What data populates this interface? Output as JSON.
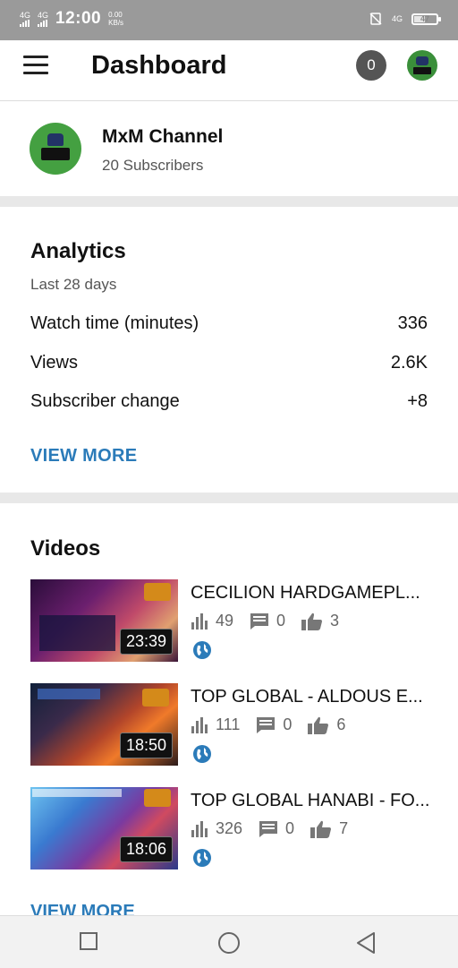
{
  "status_bar": {
    "network_1": "4G",
    "network_2": "4G",
    "time": "12:00",
    "speed_value": "0.00",
    "speed_unit": "KB/s",
    "network_right": "4G",
    "battery": "47"
  },
  "app_bar": {
    "title": "Dashboard",
    "notification_count": "0"
  },
  "channel": {
    "name": "MxM Channel",
    "subscribers": "20 Subscribers"
  },
  "analytics": {
    "heading": "Analytics",
    "period": "Last 28 days",
    "rows": [
      {
        "label": "Watch time (minutes)",
        "value": "336"
      },
      {
        "label": "Views",
        "value": "2.6K"
      },
      {
        "label": "Subscriber change",
        "value": "+8"
      }
    ],
    "view_more": "VIEW MORE"
  },
  "videos": {
    "heading": "Videos",
    "items": [
      {
        "title": "CECILION HARDGAMEPL...",
        "duration": "23:39",
        "views": "49",
        "comments": "0",
        "likes": "3"
      },
      {
        "title": "TOP GLOBAL - ALDOUS E...",
        "duration": "18:50",
        "views": "111",
        "comments": "0",
        "likes": "6"
      },
      {
        "title": "TOP GLOBAL HANABI - FO...",
        "duration": "18:06",
        "views": "326",
        "comments": "0",
        "likes": "7"
      }
    ],
    "view_more": "VIEW MORE"
  },
  "icons": {
    "menu": "hamburger-menu-icon",
    "views": "bar-chart-icon",
    "comments": "comment-icon",
    "likes": "thumbs-up-icon",
    "visibility": "globe-icon",
    "nav_recent": "square-icon",
    "nav_home": "circle-icon",
    "nav_back": "triangle-back-icon"
  },
  "colors": {
    "accent": "#2b7bb9",
    "status_bar": "#9a9a9a",
    "badge": "#555555"
  }
}
